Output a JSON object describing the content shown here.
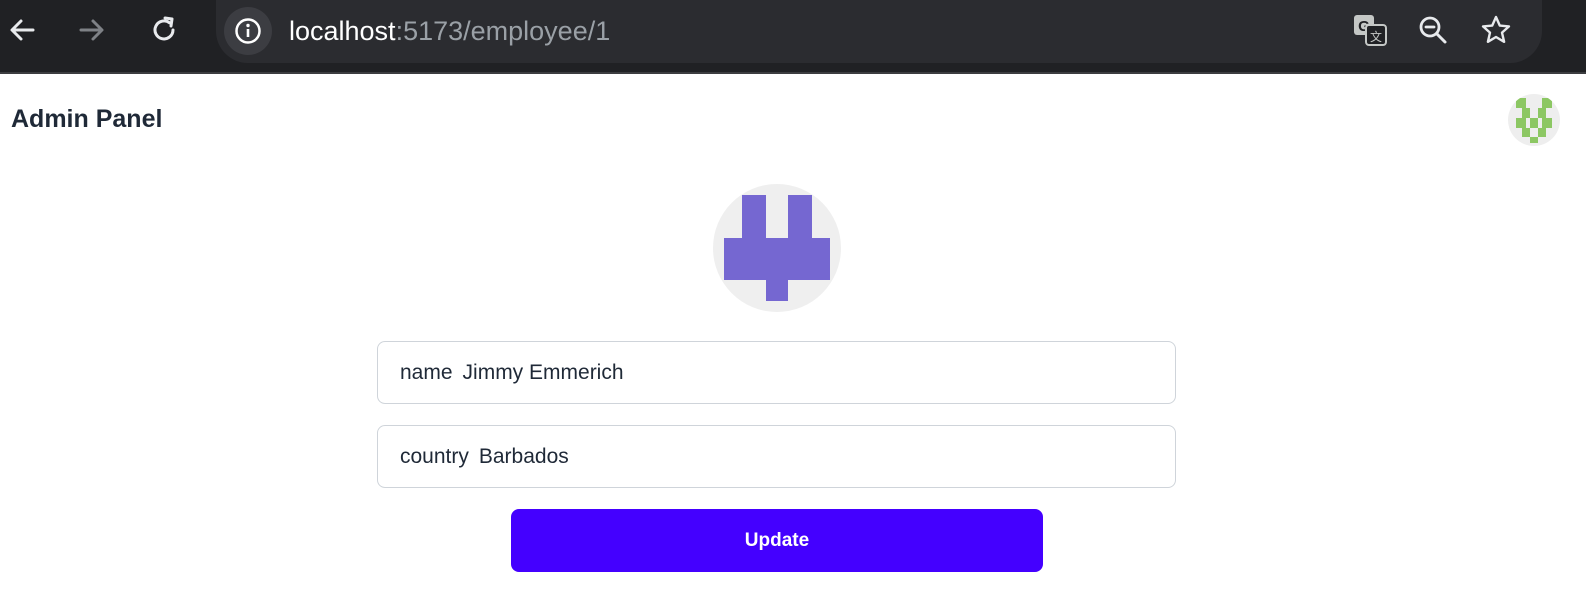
{
  "browser": {
    "url_host": "localhost",
    "url_path": ":5173/employee/1",
    "icons": [
      "back-arrow-icon",
      "forward-arrow-icon",
      "reload-icon",
      "info-icon",
      "translate-icon",
      "zoom-out-icon",
      "bookmark-star-icon"
    ]
  },
  "header": {
    "title": "Admin Panel",
    "avatar_color": "#8cc763"
  },
  "profile": {
    "avatar_color": "#7567d1"
  },
  "form": {
    "name_label": "name",
    "name_value": "Jimmy Emmerich",
    "country_label": "country",
    "country_value": "Barbados",
    "submit_label": "Update",
    "submit_color": "#4400ff"
  }
}
